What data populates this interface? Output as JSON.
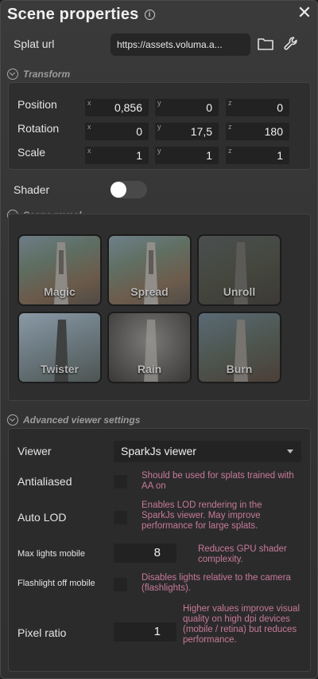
{
  "panel": {
    "title": "Scene properties"
  },
  "splat": {
    "label": "Splat url",
    "url": "https://assets.voluma.a..."
  },
  "transform": {
    "title": "Transform",
    "rows": [
      {
        "label": "Position",
        "x": "0,856",
        "y": "0",
        "z": "0"
      },
      {
        "label": "Rotation",
        "x": "0",
        "y": "17,5",
        "z": "180"
      },
      {
        "label": "Scale",
        "x": "1",
        "y": "1",
        "z": "1"
      }
    ],
    "axes": {
      "x": "x",
      "y": "y",
      "z": "z"
    }
  },
  "shader": {
    "label": "Shader",
    "enabled": false
  },
  "reveal": {
    "title": "Scene reveal",
    "effects": [
      "Magic",
      "Spread",
      "Unroll",
      "Twister",
      "Rain",
      "Burn"
    ]
  },
  "advanced": {
    "title": "Advanced viewer settings",
    "viewer": {
      "label": "Viewer",
      "value": "SparkJs viewer"
    },
    "antialiased": {
      "label": "Antialiased",
      "hint": "Should be used for splats trained with AA on"
    },
    "auto_lod": {
      "label": "Auto LOD",
      "hint": "Enables LOD rendering in the SparkJs viewer. May improve performance for large splats."
    },
    "max_lights": {
      "label": "Max lights mobile",
      "value": "8",
      "hint": "Reduces GPU shader complexity."
    },
    "flashlight": {
      "label": "Flashlight off mobile",
      "hint": "Disables lights relative to the camera (flashlights)."
    },
    "pixel_ratio": {
      "label": "Pixel ratio",
      "value": "1",
      "hint": "Higher values improve visual quality on high dpi devices (mobile / retina) but reduces performance."
    }
  },
  "colors": {
    "hint": "#c77a9a",
    "accent": "#ffffff"
  }
}
